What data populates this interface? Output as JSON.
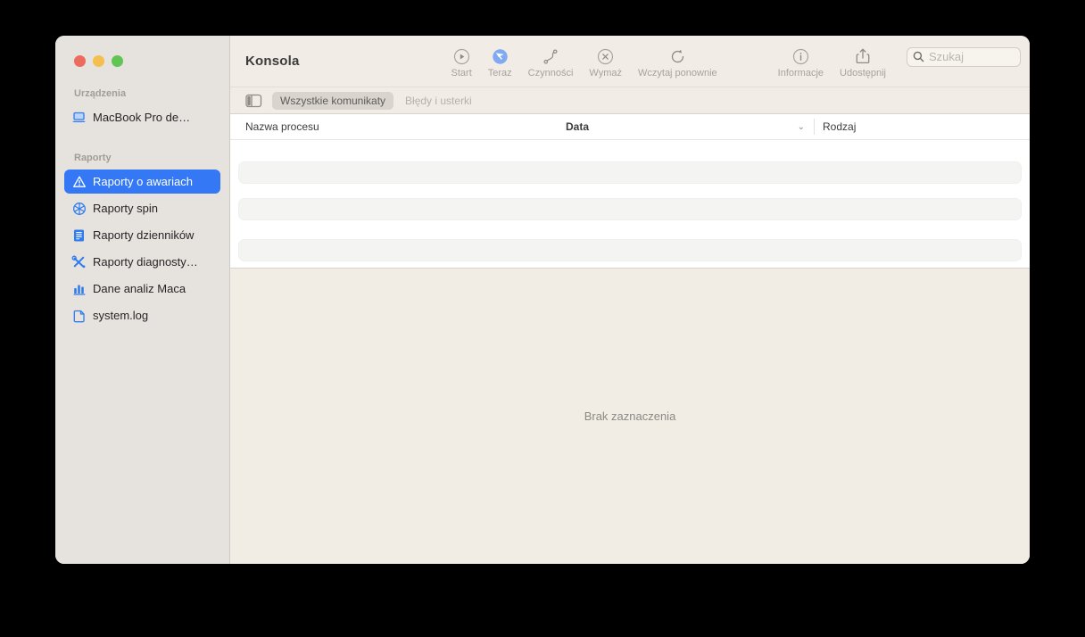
{
  "window": {
    "app_title": "Konsola"
  },
  "traffic_lights": {
    "close": "#ed6a5e",
    "minimize": "#f5bf4f",
    "zoom": "#61c554"
  },
  "colors": {
    "accent_blue": "#3478f6",
    "sidebar_bg": "#e6e2de",
    "toolbar_bg": "#f1ece5",
    "detail_bg": "#f2ede4",
    "now_icon_blue": "#7fa9f0"
  },
  "sidebar": {
    "sections": [
      {
        "label": "Urządzenia",
        "items": [
          {
            "label": "MacBook Pro de…",
            "icon": "laptop-icon",
            "selected": false
          }
        ]
      },
      {
        "label": "Raporty",
        "items": [
          {
            "label": "Raporty o awariach",
            "icon": "warning-triangle-icon",
            "selected": true
          },
          {
            "label": "Raporty spin",
            "icon": "pinwheel-icon",
            "selected": false
          },
          {
            "label": "Raporty dzienników",
            "icon": "log-document-icon",
            "selected": false
          },
          {
            "label": "Raporty diagnosty…",
            "icon": "tools-icon",
            "selected": false
          },
          {
            "label": "Dane analiz Maca",
            "icon": "bar-chart-icon",
            "selected": false
          },
          {
            "label": "system.log",
            "icon": "file-icon",
            "selected": false
          }
        ]
      }
    ]
  },
  "toolbar": {
    "title": "Konsola",
    "buttons": [
      {
        "label": "Start",
        "icon": "play-circle-icon",
        "active": false
      },
      {
        "label": "Teraz",
        "icon": "now-arrow-icon",
        "active": true
      },
      {
        "label": "Czynności",
        "icon": "actions-path-icon",
        "active": false
      },
      {
        "label": "Wymaż",
        "icon": "clear-circle-icon",
        "active": false
      },
      {
        "label": "Wczytaj ponownie",
        "icon": "reload-icon",
        "active": false
      },
      {
        "label": "Informacje",
        "icon": "info-circle-icon",
        "active": false
      },
      {
        "label": "Udostępnij",
        "icon": "share-icon",
        "active": false
      }
    ],
    "search": {
      "placeholder": "Szukaj",
      "value": ""
    }
  },
  "filter_bar": {
    "segments": [
      {
        "label": "Wszystkie komunikaty",
        "selected": true
      },
      {
        "label": "Błędy i usterki",
        "selected": false
      }
    ]
  },
  "table": {
    "columns": [
      {
        "label": "Nazwa procesu",
        "sorted": false
      },
      {
        "label": "Data",
        "sorted": true,
        "sort_indicator": "⌄"
      },
      {
        "label": "Rodzaj",
        "sorted": false
      }
    ],
    "placeholder_row_count": 3,
    "rows": []
  },
  "detail_panel": {
    "empty_text": "Brak zaznaczenia"
  }
}
